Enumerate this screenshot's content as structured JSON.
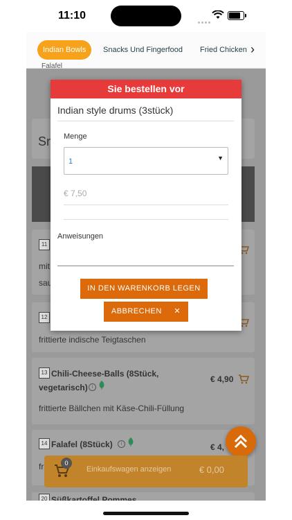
{
  "status": {
    "time": "11:10"
  },
  "categories": [
    {
      "label": "Indian Bowls",
      "active": true
    },
    {
      "label": "Snacks Und Fingerfood",
      "active": false
    },
    {
      "label": "Fried Chicken",
      "active": false
    }
  ],
  "background": {
    "top_fragment": "Falafel",
    "section_title_partial": "Sn",
    "item11": {
      "num": "11",
      "line1": "mit",
      "line2": "sau"
    },
    "item12": {
      "num": "12",
      "desc": "frittierte indische Teigtaschen"
    },
    "item13": {
      "num": "13",
      "name_l1": "Chili-Cheese-Balls (8Stück,",
      "name_l2": "vegetarisch)",
      "price": "€ 4,90",
      "desc": "frittierte Bällchen mit Käse-Chili-Füllung"
    },
    "item14": {
      "num": "14",
      "name": "Falafel (8Stück)",
      "price": "€ 4,",
      "desc": "fr"
    },
    "item20": {
      "num": "20",
      "name": "Süßkartoffel Pommes"
    }
  },
  "modal": {
    "header": "Sie bestellen vor",
    "product": "Indian style drums (3stück)",
    "quantity_label": "Menge",
    "quantity_value": "1",
    "price": "€ 7,50",
    "instructions_label": "Anweisungen",
    "add_to_cart": "IN DEN WARENKORB LEGEN",
    "cancel": "ABBRECHEN",
    "cancel_icon": "✕"
  },
  "basket": {
    "count": "0",
    "label": "Einkaufswagen anzeigen",
    "total": "€ 0,00"
  },
  "colors": {
    "accent": "#f7a21b",
    "modal_header": "#e73a3a",
    "button": "#dc6a0a"
  }
}
